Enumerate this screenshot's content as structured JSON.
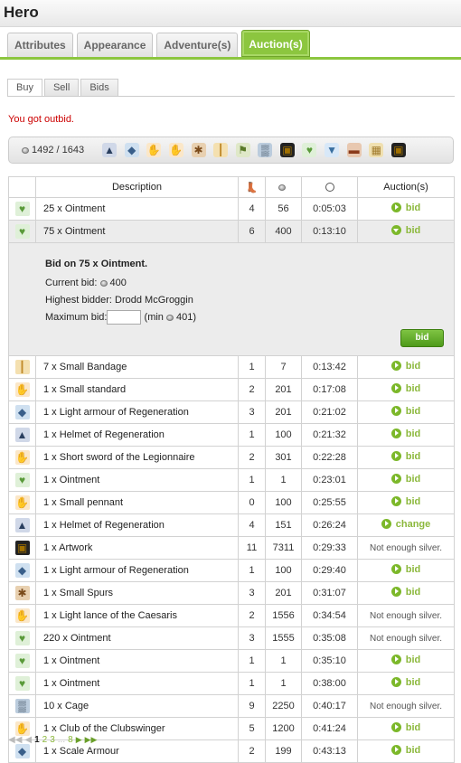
{
  "window": {
    "title": "Hero"
  },
  "main_tabs": [
    {
      "label": "Attributes"
    },
    {
      "label": "Appearance"
    },
    {
      "label": "Adventure(s)"
    },
    {
      "label": "Auction(s)"
    }
  ],
  "sub_tabs": [
    {
      "label": "Buy"
    },
    {
      "label": "Sell"
    },
    {
      "label": "Bids"
    }
  ],
  "notice": "You got outbid.",
  "silver": "1492 / 1643",
  "inventory_icons": [
    "helmet-icon",
    "armour-icon",
    "hand-icon",
    "hand-icon",
    "spurs-icon",
    "bandage-icon",
    "pennant-icon",
    "cage-icon",
    "artwork-icon",
    "ointment-icon",
    "bucket-icon",
    "book-icon",
    "map-icon",
    "artwork-icon"
  ],
  "table": {
    "headers": {
      "description": "Description"
    },
    "rows": [
      {
        "icon": "ointment-icon",
        "description": "25 x Ointment",
        "quality": "4",
        "price": "56",
        "time": "0:05:03",
        "action": "bid"
      },
      {
        "icon": "ointment-icon",
        "description": "75 x Ointment",
        "quality": "6",
        "price": "400",
        "time": "0:13:10",
        "action": "bid"
      },
      {
        "icon": "bandage-icon",
        "description": "7 x Small Bandage",
        "quality": "1",
        "price": "7",
        "time": "0:13:42",
        "action": "bid"
      },
      {
        "icon": "hand-icon",
        "description": "1 x Small standard",
        "quality": "2",
        "price": "201",
        "time": "0:17:08",
        "action": "bid"
      },
      {
        "icon": "armour-icon",
        "description": "1 x Light armour of Regeneration",
        "quality": "3",
        "price": "201",
        "time": "0:21:02",
        "action": "bid"
      },
      {
        "icon": "helmet-icon",
        "description": "1 x Helmet of Regeneration",
        "quality": "1",
        "price": "100",
        "time": "0:21:32",
        "action": "bid"
      },
      {
        "icon": "hand-icon",
        "description": "1 x Short sword of the Legionnaire",
        "quality": "2",
        "price": "301",
        "time": "0:22:28",
        "action": "bid"
      },
      {
        "icon": "ointment-icon",
        "description": "1 x Ointment",
        "quality": "1",
        "price": "1",
        "time": "0:23:01",
        "action": "bid"
      },
      {
        "icon": "hand-icon",
        "description": "1 x Small pennant",
        "quality": "0",
        "price": "100",
        "time": "0:25:55",
        "action": "bid"
      },
      {
        "icon": "helmet-icon",
        "description": "1 x Helmet of Regeneration",
        "quality": "4",
        "price": "151",
        "time": "0:26:24",
        "action": "change"
      },
      {
        "icon": "artwork-icon",
        "description": "1 x Artwork",
        "quality": "11",
        "price": "7311",
        "time": "0:29:33",
        "action": "Not enough silver."
      },
      {
        "icon": "armour-icon",
        "description": "1 x Light armour of Regeneration",
        "quality": "1",
        "price": "100",
        "time": "0:29:40",
        "action": "bid"
      },
      {
        "icon": "spurs-icon",
        "description": "1 x Small Spurs",
        "quality": "3",
        "price": "201",
        "time": "0:31:07",
        "action": "bid"
      },
      {
        "icon": "hand-icon",
        "description": "1 x Light lance of the Caesaris",
        "quality": "2",
        "price": "1556",
        "time": "0:34:54",
        "action": "Not enough silver."
      },
      {
        "icon": "ointment-icon",
        "description": "220 x Ointment",
        "quality": "3",
        "price": "1555",
        "time": "0:35:08",
        "action": "Not enough silver."
      },
      {
        "icon": "ointment-icon",
        "description": "1 x Ointment",
        "quality": "1",
        "price": "1",
        "time": "0:35:10",
        "action": "bid"
      },
      {
        "icon": "ointment-icon",
        "description": "1 x Ointment",
        "quality": "1",
        "price": "1",
        "time": "0:38:00",
        "action": "bid"
      },
      {
        "icon": "cage-icon",
        "description": "10 x Cage",
        "quality": "9",
        "price": "2250",
        "time": "0:40:17",
        "action": "Not enough silver."
      },
      {
        "icon": "hand-icon",
        "description": "1 x Club of the Clubswinger",
        "quality": "5",
        "price": "1200",
        "time": "0:41:24",
        "action": "bid"
      },
      {
        "icon": "armour-icon",
        "description": "1 x Scale Armour",
        "quality": "2",
        "price": "199",
        "time": "0:43:13",
        "action": "bid"
      }
    ]
  },
  "bid_panel": {
    "heading": "Bid on 75 x Ointment.",
    "current_bid_label": "Current bid:",
    "current_bid": "400",
    "highest_bidder": "Highest bidder: Drodd McGroggin",
    "max_bid_label": "Maximum bid:",
    "min_prefix": "(min",
    "min_value": "401)",
    "button": "bid"
  },
  "pager": {
    "pages": [
      "1",
      "2",
      "3",
      "...",
      "8"
    ]
  },
  "colors": {
    "accent": "#8cc63f",
    "link": "#8cb83c",
    "error": "#cc0000"
  }
}
